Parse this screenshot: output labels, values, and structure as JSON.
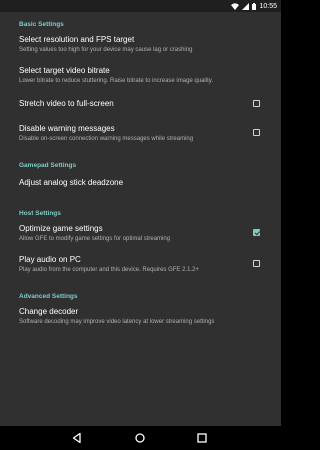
{
  "status_bar": {
    "time": "10:55",
    "icons": [
      "wifi-icon",
      "signal-icon",
      "battery-icon"
    ]
  },
  "sections": {
    "basic": {
      "header": "Basic Settings",
      "resolution": {
        "title": "Select resolution and FPS target",
        "summary": "Setting values too high for your device may cause lag or crashing"
      },
      "bitrate": {
        "title": "Select target video bitrate",
        "summary": "Lower bitrate to reduce stuttering. Raise bitrate to increase image quality."
      },
      "stretch": {
        "title": "Stretch video to full-screen",
        "checked": false
      },
      "warnings": {
        "title": "Disable warning messages",
        "summary": "Disable on-screen connection warning messages while streaming",
        "checked": false
      }
    },
    "gamepad": {
      "header": "Gamepad Settings",
      "deadzone": {
        "title": "Adjust analog stick deadzone"
      }
    },
    "host": {
      "header": "Host Settings",
      "optimize": {
        "title": "Optimize game settings",
        "summary": "Allow GFE to modify game settings for optimal streaming",
        "checked": true
      },
      "audio": {
        "title": "Play audio on PC",
        "summary": "Play audio from the computer and this device. Requires GFE 2.1.2+",
        "checked": false
      }
    },
    "advanced": {
      "header": "Advanced Settings",
      "decoder": {
        "title": "Change decoder",
        "summary": "Software decoding may improve video latency at lower streaming settings"
      }
    }
  },
  "nav_bar": {
    "icons": [
      "back-icon",
      "home-icon",
      "recents-icon"
    ]
  },
  "colors": {
    "accent": "#80cbc4",
    "background": "#303030",
    "status_bar": "#1f1f1f"
  }
}
